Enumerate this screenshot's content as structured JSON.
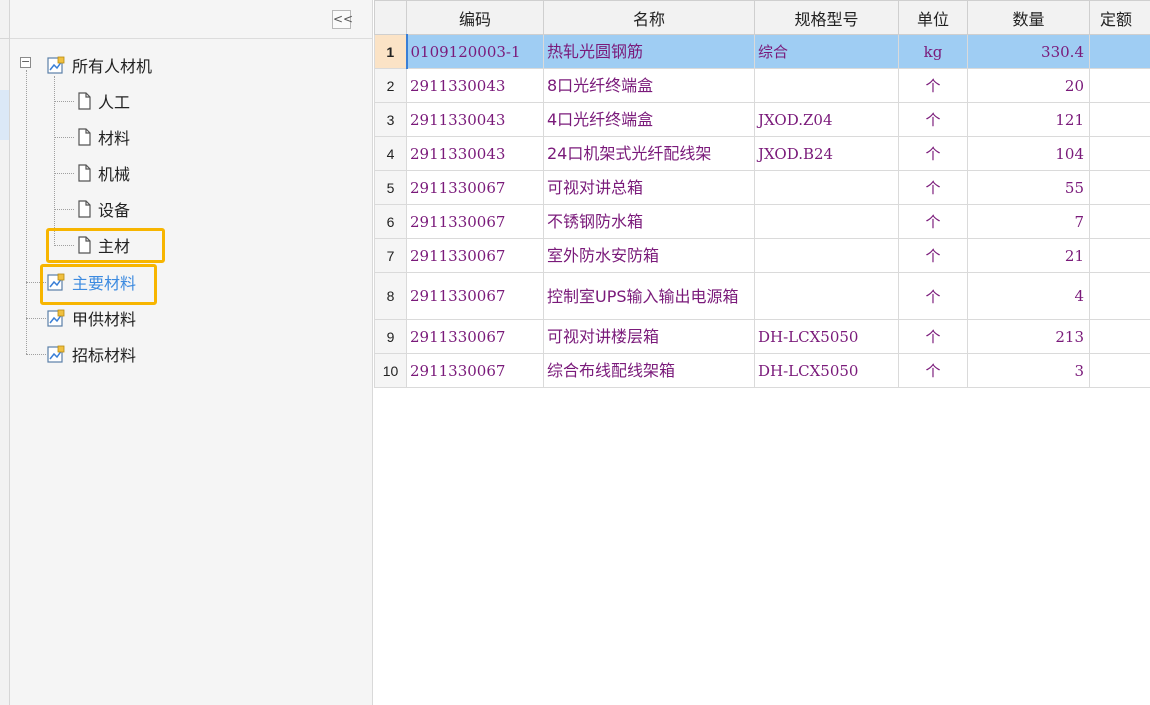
{
  "sidebar": {
    "collapse_label": "<<",
    "tree": {
      "root": "所有人材机",
      "children": [
        "人工",
        "材料",
        "机械",
        "设备",
        "主材"
      ],
      "others": [
        "主要材料",
        "甲供材料",
        "招标材料"
      ]
    },
    "active_item": "主要材料",
    "highlight_color": "#f7b500"
  },
  "grid": {
    "columns": [
      "编码",
      "名称",
      "规格型号",
      "单位",
      "数量",
      "定额"
    ],
    "selected_row": 1,
    "rows": [
      {
        "n": "1",
        "code": "0109120003-1",
        "name": "热轧光圆钢筋",
        "spec": "综合",
        "unit": "kg",
        "qty": "330.4"
      },
      {
        "n": "2",
        "code": "2911330043",
        "name": "8口光纤终端盒",
        "spec": "",
        "unit": "个",
        "qty": "20"
      },
      {
        "n": "3",
        "code": "2911330043",
        "name": "4口光纤终端盒",
        "spec": "JXOD.Z04",
        "unit": "个",
        "qty": "121"
      },
      {
        "n": "4",
        "code": "2911330043",
        "name": "24口机架式光纤配线架",
        "spec": "JXOD.B24",
        "unit": "个",
        "qty": "104"
      },
      {
        "n": "5",
        "code": "2911330067",
        "name": "可视对讲总箱",
        "spec": "",
        "unit": "个",
        "qty": "55"
      },
      {
        "n": "6",
        "code": "2911330067",
        "name": "不锈钢防水箱",
        "spec": "",
        "unit": "个",
        "qty": "7"
      },
      {
        "n": "7",
        "code": "2911330067",
        "name": "室外防水安防箱",
        "spec": "",
        "unit": "个",
        "qty": "21"
      },
      {
        "n": "8",
        "code": "2911330067",
        "name": "控制室UPS输入输出电源箱",
        "spec": "",
        "unit": "个",
        "qty": "4"
      },
      {
        "n": "9",
        "code": "2911330067",
        "name": "可视对讲楼层箱",
        "spec": "DH-LCX5050",
        "unit": "个",
        "qty": "213"
      },
      {
        "n": "10",
        "code": "2911330067",
        "name": "综合布线配线架箱",
        "spec": "DH-LCX5050",
        "unit": "个",
        "qty": "3"
      }
    ]
  },
  "colors": {
    "selected_row_bg": "#9fcdf3",
    "text_purple": "#7a1a7a",
    "active_text": "#3d8be0"
  }
}
